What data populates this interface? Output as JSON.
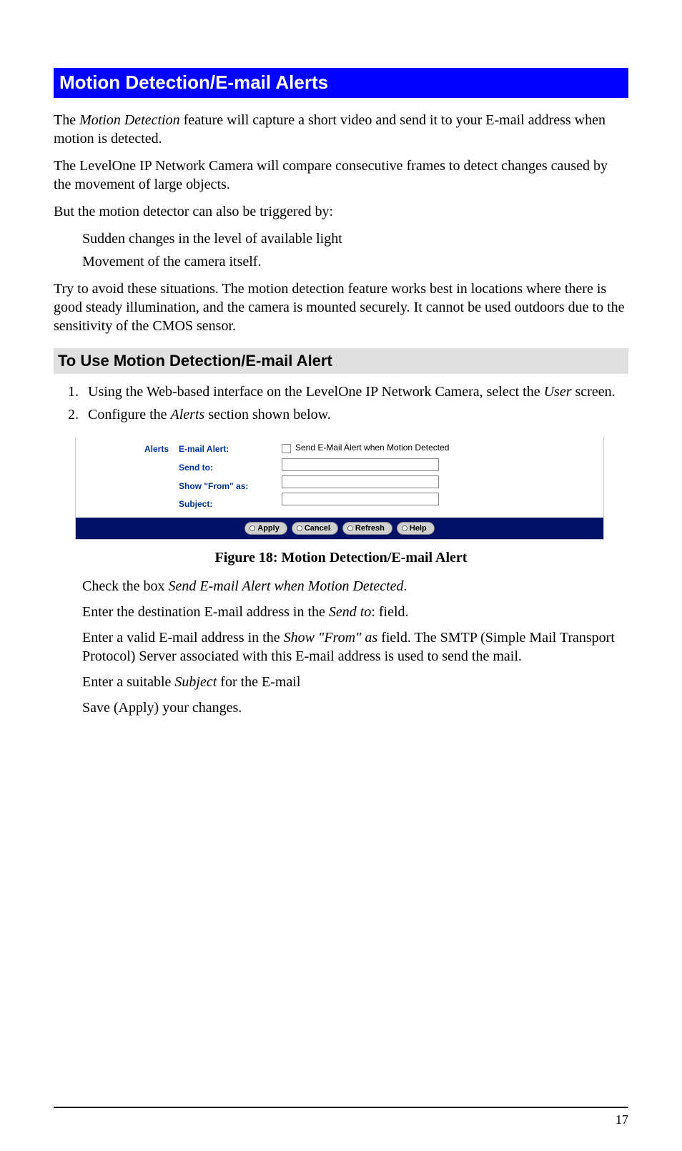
{
  "title": "Motion Detection/E-mail Alerts",
  "p1_a": "The ",
  "p1_b": "Motion Detection",
  "p1_c": " feature will capture a short video and send it to your E-mail address when motion is detected.",
  "p2": "The LevelOne IP Network Camera will compare consecutive frames to detect changes caused by the movement of large objects.",
  "p3": "But the motion detector can also be triggered by:",
  "bullets": {
    "b1": "Sudden changes in the level of available light",
    "b2": "Movement of the camera itself."
  },
  "p4": "Try to avoid these situations. The motion detection feature works best in locations where there is good steady illumination, and the camera is mounted securely. It cannot be used outdoors due to the sensitivity of the CMOS sensor.",
  "section": "To Use Motion Detection/E-mail Alert",
  "steps": {
    "s1_a": "Using the Web-based interface on the LevelOne IP Network Camera, select the ",
    "s1_b": "User",
    "s1_c": " screen.",
    "s2_a": "Configure the ",
    "s2_b": "Alerts",
    "s2_c": " section shown below."
  },
  "panel": {
    "side": "Alerts",
    "labels": {
      "email_alert": "E-mail Alert:",
      "send_to": "Send to:",
      "show_from": "Show \"From\" as:",
      "subject": "Subject:"
    },
    "checkbox_label": "Send E-Mail Alert when Motion Detected",
    "fields": {
      "send_to": "",
      "show_from": "",
      "subject": ""
    },
    "buttons": {
      "apply": "Apply",
      "cancel": "Cancel",
      "refresh": "Refresh",
      "help": "Help"
    }
  },
  "figure_caption": "Figure 18: Motion Detection/E-mail Alert",
  "instr": {
    "i1_a": "Check the box ",
    "i1_b": "Send E-mail Alert when Motion Detected",
    "i1_c": ".",
    "i2_a": "Enter the destination E-mail address in the ",
    "i2_b": "Send to",
    "i2_c": ": field.",
    "i3_a": "Enter a valid E-mail address in the ",
    "i3_b": "Show \"From\" as",
    "i3_c": " field. The SMTP (Simple Mail Transport Protocol) Server associated with this E-mail address is used to send the mail.",
    "i4_a": "Enter a suitable ",
    "i4_b": "Subject",
    "i4_c": " for the E-mail",
    "i5": "Save (Apply) your changes."
  },
  "page_number": "17"
}
